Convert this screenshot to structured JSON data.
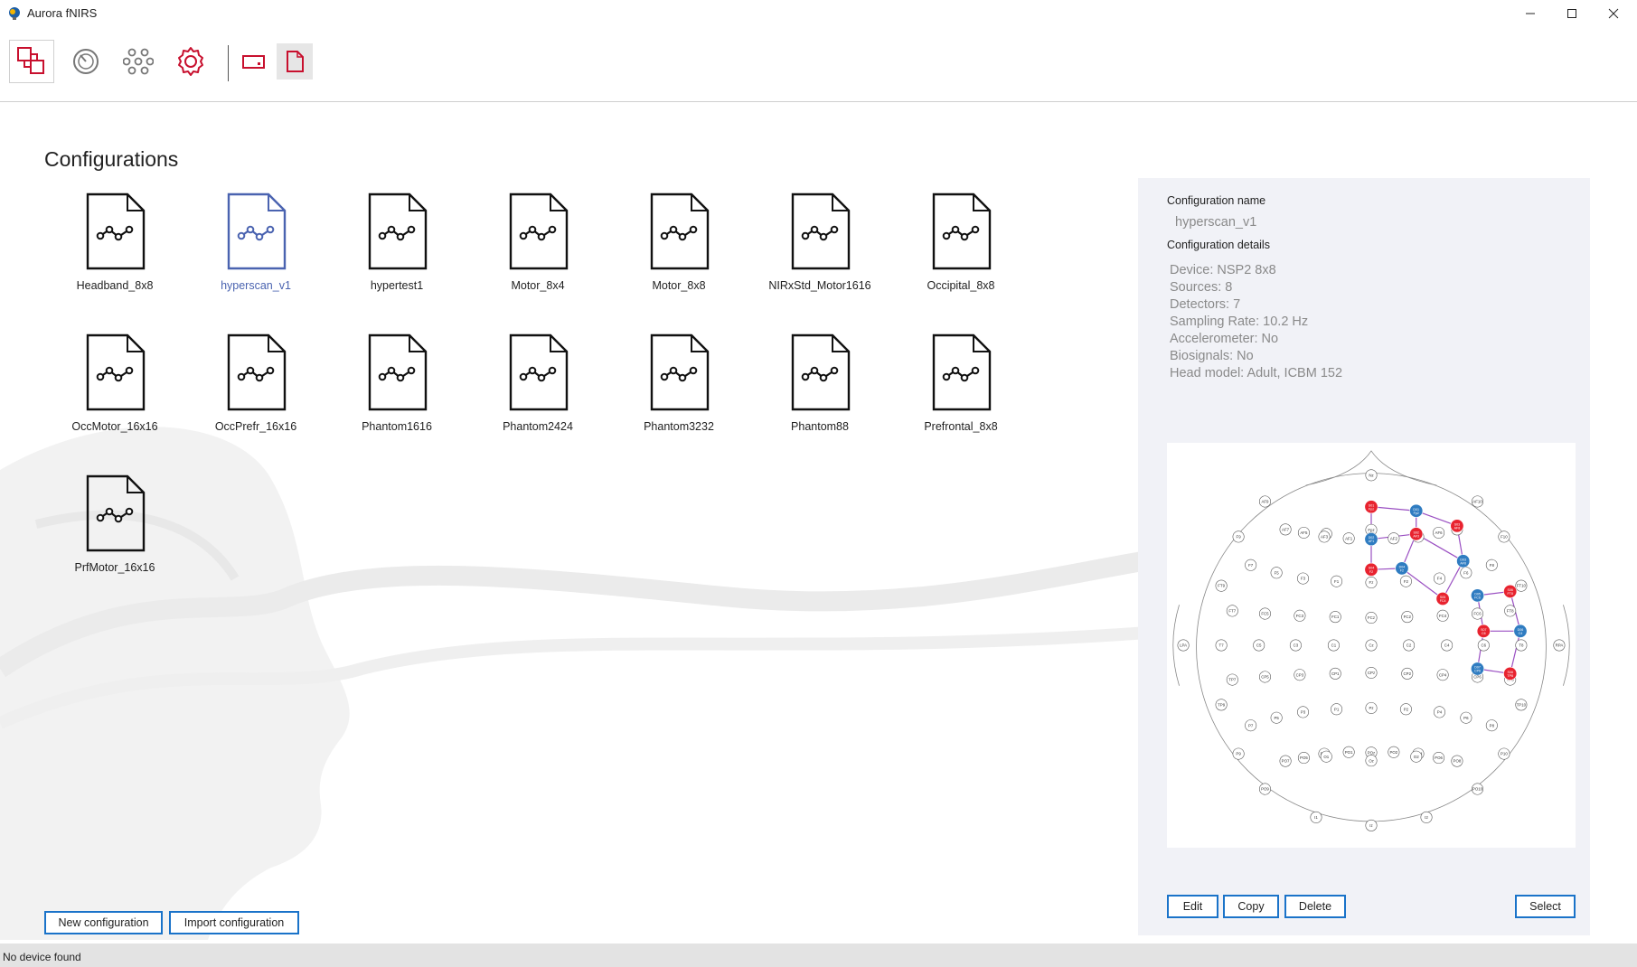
{
  "window": {
    "title": "Aurora fNIRS"
  },
  "colors": {
    "accent_red": "#c8102e",
    "selection_blue": "#4a63b0",
    "button_border": "#1a73c9",
    "source_red": "#e8232f",
    "detector_blue": "#2f7cc1",
    "channel_purple": "#9a4fc2"
  },
  "toolbar": {
    "items": [
      "configurations-icon",
      "dashboard-icon",
      "network-icon",
      "settings-icon",
      "device-icon",
      "document-icon"
    ]
  },
  "page": {
    "title": "Configurations"
  },
  "configs": [
    {
      "label": "Headband_8x8"
    },
    {
      "label": "hyperscan_v1"
    },
    {
      "label": "hypertest1"
    },
    {
      "label": "Motor_8x4"
    },
    {
      "label": "Motor_8x8"
    },
    {
      "label": "NIRxStd_Motor1616"
    },
    {
      "label": "Occipital_8x8"
    },
    {
      "label": "OccMotor_16x16"
    },
    {
      "label": "OccPrefr_16x16"
    },
    {
      "label": "Phantom1616"
    },
    {
      "label": "Phantom2424"
    },
    {
      "label": "Phantom3232"
    },
    {
      "label": "Phantom88"
    },
    {
      "label": "Prefrontal_8x8"
    },
    {
      "label": "PrfMotor_16x16"
    }
  ],
  "selected_config": "hyperscan_v1",
  "details": {
    "name_label": "Configuration name",
    "name_value": "hyperscan_v1",
    "details_label": "Configuration details",
    "device": "Device: NSP2 8x8",
    "sources": "Sources:  8",
    "detectors": "Detectors:  7",
    "sampling_rate": "Sampling Rate: 10.2 Hz",
    "accelerometer": "Accelerometer: No",
    "biosignals": "Biosignals: No",
    "head_model": "Head model: Adult, ICBM 152"
  },
  "buttons": {
    "new_config": "New configuration",
    "import_config": "Import configuration",
    "edit": "Edit",
    "copy": "Copy",
    "delete": "Delete",
    "select": "Select"
  },
  "status": {
    "text": "No device found"
  },
  "montage": {
    "electrodes": [
      [
        "Nz",
        0.5,
        0.08
      ],
      [
        "Fpz",
        0.5,
        0.215
      ],
      [
        "AF9",
        0.24,
        0.145
      ],
      [
        "AF10",
        0.76,
        0.145
      ],
      [
        "Fp1",
        0.39,
        0.225
      ],
      [
        "Fp2",
        0.61,
        0.225
      ],
      [
        "AF7",
        0.29,
        0.214
      ],
      [
        "AF5",
        0.335,
        0.222
      ],
      [
        "AF3",
        0.385,
        0.232
      ],
      [
        "AF1",
        0.445,
        0.236
      ],
      [
        "AFz",
        0.5,
        0.235
      ],
      [
        "AF2",
        0.555,
        0.236
      ],
      [
        "AF4",
        0.615,
        0.232
      ],
      [
        "AF6",
        0.665,
        0.222
      ],
      [
        "AF8",
        0.71,
        0.214
      ],
      [
        "F9",
        0.175,
        0.232
      ],
      [
        "F10",
        0.825,
        0.232
      ],
      [
        "F7",
        0.205,
        0.302
      ],
      [
        "F5",
        0.268,
        0.321
      ],
      [
        "F3",
        0.333,
        0.335
      ],
      [
        "F1",
        0.415,
        0.342
      ],
      [
        "Fz",
        0.5,
        0.345
      ],
      [
        "F2",
        0.585,
        0.342
      ],
      [
        "F4",
        0.667,
        0.335
      ],
      [
        "F6",
        0.732,
        0.321
      ],
      [
        "F8",
        0.795,
        0.302
      ],
      [
        "FT9",
        0.133,
        0.353
      ],
      [
        "FT10",
        0.867,
        0.353
      ],
      [
        "FT7",
        0.16,
        0.415
      ],
      [
        "FC5",
        0.24,
        0.422
      ],
      [
        "FC3",
        0.325,
        0.427
      ],
      [
        "FC1",
        0.412,
        0.43
      ],
      [
        "FCz",
        0.5,
        0.432
      ],
      [
        "FC2",
        0.588,
        0.43
      ],
      [
        "FC4",
        0.675,
        0.427
      ],
      [
        "FC6",
        0.76,
        0.422
      ],
      [
        "FT8",
        0.84,
        0.415
      ],
      [
        "LPA",
        0.04,
        0.5
      ],
      [
        "T7",
        0.133,
        0.5
      ],
      [
        "C5",
        0.225,
        0.5
      ],
      [
        "C3",
        0.315,
        0.5
      ],
      [
        "C1",
        0.408,
        0.5
      ],
      [
        "Cz",
        0.5,
        0.5
      ],
      [
        "C2",
        0.592,
        0.5
      ],
      [
        "C4",
        0.685,
        0.5
      ],
      [
        "C6",
        0.775,
        0.5
      ],
      [
        "T8",
        0.867,
        0.5
      ],
      [
        "RPA",
        0.96,
        0.5
      ],
      [
        "TP7",
        0.16,
        0.585
      ],
      [
        "CP5",
        0.24,
        0.578
      ],
      [
        "CP3",
        0.325,
        0.573
      ],
      [
        "CP1",
        0.412,
        0.57
      ],
      [
        "CPz",
        0.5,
        0.568
      ],
      [
        "CP2",
        0.588,
        0.57
      ],
      [
        "CP4",
        0.675,
        0.573
      ],
      [
        "CP6",
        0.76,
        0.578
      ],
      [
        "TP8",
        0.84,
        0.585
      ],
      [
        "TP9",
        0.133,
        0.647
      ],
      [
        "TP10",
        0.867,
        0.647
      ],
      [
        "P7",
        0.205,
        0.698
      ],
      [
        "P5",
        0.268,
        0.679
      ],
      [
        "P3",
        0.333,
        0.665
      ],
      [
        "P1",
        0.415,
        0.658
      ],
      [
        "Pz",
        0.5,
        0.655
      ],
      [
        "P2",
        0.585,
        0.658
      ],
      [
        "P4",
        0.667,
        0.665
      ],
      [
        "P6",
        0.732,
        0.679
      ],
      [
        "P8",
        0.795,
        0.698
      ],
      [
        "P9",
        0.175,
        0.768
      ],
      [
        "P10",
        0.825,
        0.768
      ],
      [
        "PO7",
        0.29,
        0.786
      ],
      [
        "PO5",
        0.335,
        0.778
      ],
      [
        "PO3",
        0.385,
        0.768
      ],
      [
        "PO1",
        0.445,
        0.764
      ],
      [
        "POz",
        0.5,
        0.765
      ],
      [
        "PO2",
        0.555,
        0.764
      ],
      [
        "PO4",
        0.615,
        0.768
      ],
      [
        "PO6",
        0.665,
        0.778
      ],
      [
        "PO8",
        0.71,
        0.786
      ],
      [
        "PO9",
        0.24,
        0.855
      ],
      [
        "PO10",
        0.76,
        0.855
      ],
      [
        "O1",
        0.39,
        0.775
      ],
      [
        "Oz",
        0.5,
        0.785
      ],
      [
        "O2",
        0.61,
        0.775
      ],
      [
        "I1",
        0.365,
        0.925
      ],
      [
        "Iz",
        0.5,
        0.945
      ],
      [
        "I2",
        0.635,
        0.925
      ]
    ],
    "sources": [
      [
        "S01 Fpz",
        0.5,
        0.158
      ],
      [
        "S02 AF3",
        0.61,
        0.225
      ],
      [
        "S03 AF8",
        0.71,
        0.205
      ],
      [
        "S04 F2",
        0.5,
        0.313
      ],
      [
        "S05 FC4",
        0.675,
        0.385
      ],
      [
        "S06 FT8",
        0.84,
        0.367
      ],
      [
        "S07 C6",
        0.775,
        0.465
      ],
      [
        "S08 TP8",
        0.84,
        0.57
      ]
    ],
    "detectors": [
      [
        "D01 Fp2",
        0.61,
        0.168
      ],
      [
        "D02 AF1",
        0.5,
        0.238
      ],
      [
        "D03 AF6",
        0.725,
        0.292
      ],
      [
        "D04 F2",
        0.575,
        0.31
      ],
      [
        "D05 FC6",
        0.76,
        0.377
      ],
      [
        "D06 C4",
        0.865,
        0.465
      ],
      [
        "D07 CP6",
        0.76,
        0.558
      ]
    ],
    "channels": [
      [
        "S01 Fpz",
        "D01 Fp2"
      ],
      [
        "S01 Fpz",
        "D02 AF1"
      ],
      [
        "S02 AF3",
        "D01 Fp2"
      ],
      [
        "S02 AF3",
        "D02 AF1"
      ],
      [
        "S02 AF3",
        "D04 F2"
      ],
      [
        "S02 AF3",
        "D03 AF6"
      ],
      [
        "S03 AF8",
        "D01 Fp2"
      ],
      [
        "S03 AF8",
        "D03 AF6"
      ],
      [
        "S04 F2",
        "D02 AF1"
      ],
      [
        "S04 F2",
        "D04 F2"
      ],
      [
        "S05 FC4",
        "D04 F2"
      ],
      [
        "S05 FC4",
        "D03 AF6"
      ],
      [
        "S06 FT8",
        "D05 FC6"
      ],
      [
        "S07 C6",
        "D05 FC6"
      ],
      [
        "S07 C6",
        "D06 C4"
      ],
      [
        "S07 C6",
        "D07 CP6"
      ],
      [
        "S08 TP8",
        "D06 C4"
      ],
      [
        "S08 TP8",
        "D07 CP6"
      ],
      [
        "S06 FT8",
        "D06 C4"
      ]
    ]
  }
}
